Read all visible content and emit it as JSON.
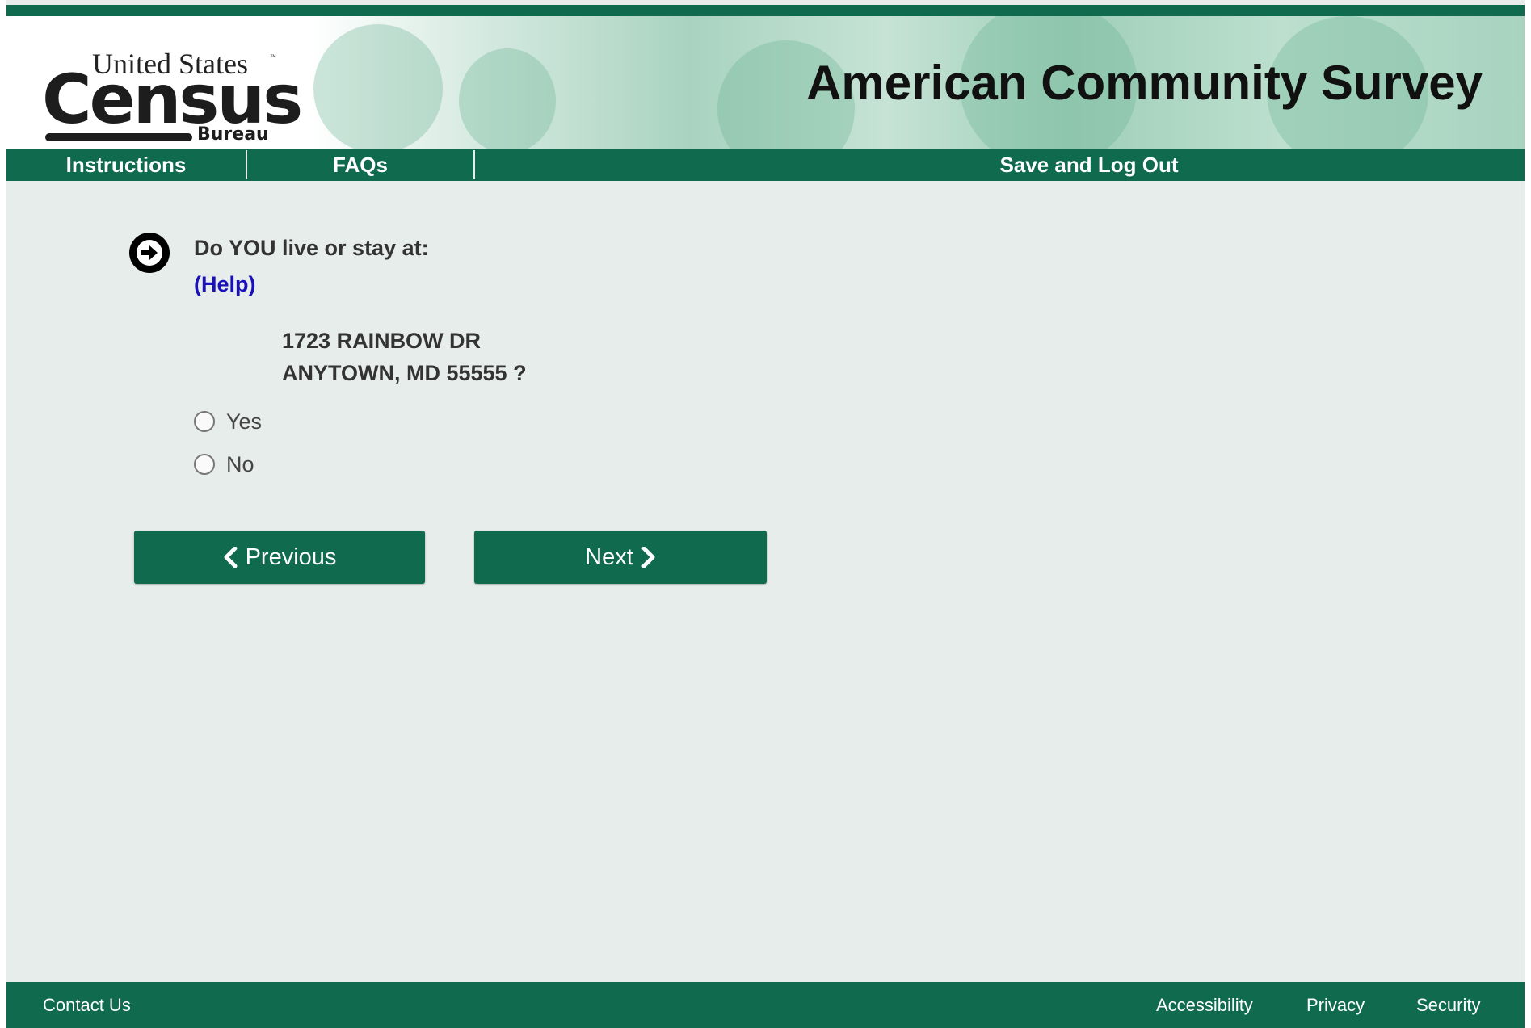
{
  "header": {
    "logo": {
      "line1": "United States",
      "tm": "™",
      "line2": "Census",
      "line3": "Bureau"
    },
    "app_title": "American Community Survey"
  },
  "nav": {
    "instructions": "Instructions",
    "faqs": "FAQs",
    "save_logout": "Save and Log Out"
  },
  "question": {
    "icon": "arrow-right-circle-icon",
    "text": "Do YOU live or stay at:",
    "help": "(Help)",
    "address_line1": "1723 RAINBOW DR",
    "address_line2": "ANYTOWN, MD 55555 ?",
    "options": [
      "Yes",
      "No"
    ],
    "selected": null
  },
  "buttons": {
    "previous": "Previous",
    "next": "Next"
  },
  "footer": {
    "contact": "Contact Us",
    "accessibility": "Accessibility",
    "privacy": "Privacy",
    "security": "Security"
  },
  "colors": {
    "brand_green": "#0f6a4e",
    "page_bg": "#e6edea",
    "help_link": "#1a12b8"
  }
}
